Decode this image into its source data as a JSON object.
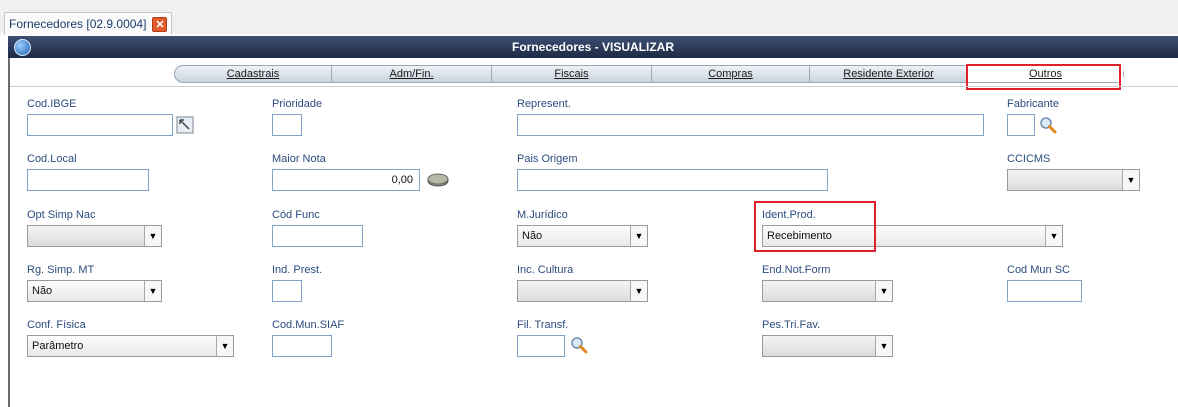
{
  "document_tab": {
    "title": "Fornecedores [02.9.0004]",
    "close_glyph": "✕"
  },
  "window": {
    "title": "Fornecedores - VISUALIZAR",
    "icon": "app-icon"
  },
  "folder_tabs": [
    {
      "label": "Cadastrais"
    },
    {
      "label": "Adm/Fin."
    },
    {
      "label": "Fiscais"
    },
    {
      "label": "Compras"
    },
    {
      "label": "Residente Exterior"
    },
    {
      "label": "Outros",
      "active": true
    }
  ],
  "fields": {
    "cod_ibge": {
      "label": "Cod.IBGE",
      "value": ""
    },
    "prioridade": {
      "label": "Prioridade",
      "value": ""
    },
    "represent": {
      "label": "Represent.",
      "value": ""
    },
    "fabricante": {
      "label": "Fabricante",
      "value": ""
    },
    "cod_local": {
      "label": "Cod.Local",
      "value": ""
    },
    "maior_nota": {
      "label": "Maior Nota",
      "value": "0,00"
    },
    "pais_origem": {
      "label": "Pais Origem",
      "value": ""
    },
    "ccicms": {
      "label": "CCICMS",
      "value": ""
    },
    "opt_simp_nac": {
      "label": "Opt Simp Nac",
      "value": ""
    },
    "cod_func": {
      "label": "Cód Func",
      "value": ""
    },
    "m_juridico": {
      "label": "M.Jurídico",
      "value": "Não"
    },
    "ident_prod": {
      "label": "Ident.Prod.",
      "value": "Recebimento"
    },
    "rg_simp_mt": {
      "label": "Rg. Simp. MT",
      "value": "Não"
    },
    "ind_prest": {
      "label": "Ind. Prest.",
      "value": ""
    },
    "inc_cultura": {
      "label": "Inc. Cultura",
      "value": ""
    },
    "end_not_form": {
      "label": "End.Not.Form",
      "value": ""
    },
    "cod_mun_sc": {
      "label": "Cod Mun SC",
      "value": ""
    },
    "conf_fisica": {
      "label": "Conf. Física",
      "value": "Parâmetro"
    },
    "cod_mun_siaf": {
      "label": "Cod.Mun.SIAF",
      "value": ""
    },
    "fil_transf": {
      "label": "Fil. Transf.",
      "value": ""
    },
    "pes_tri_fav": {
      "label": "Pes.Tri.Fav.",
      "value": ""
    }
  },
  "highlight_color": "#e0202a"
}
